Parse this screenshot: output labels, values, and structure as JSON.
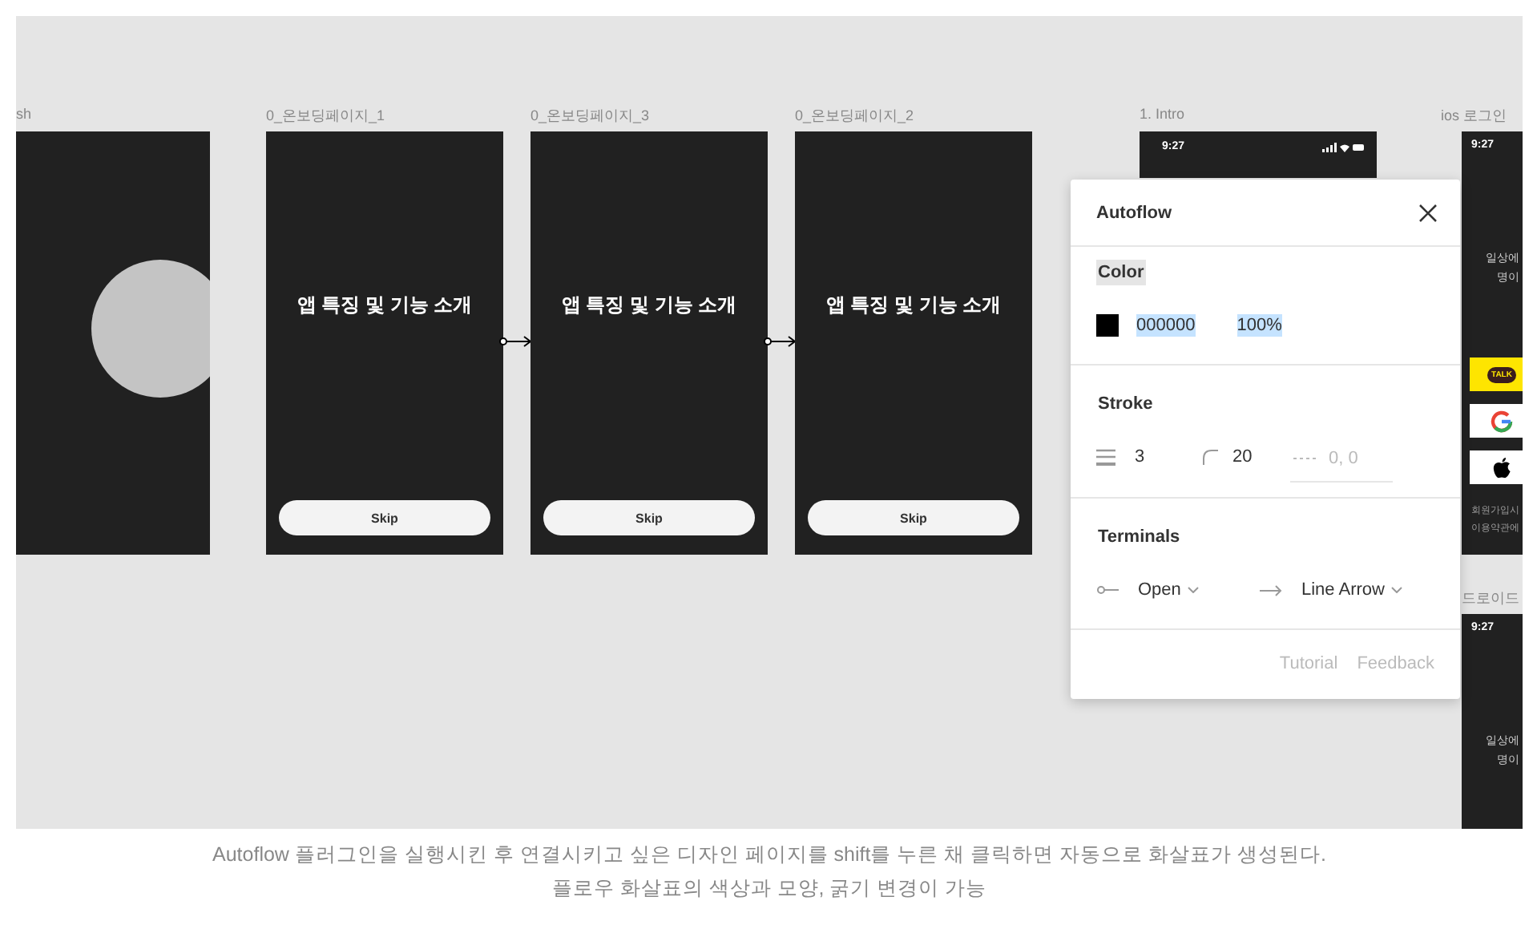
{
  "canvas": {
    "frames": [
      {
        "kind": "splash",
        "label": "sh"
      },
      {
        "kind": "onboarding",
        "label": "0_온보딩페이지_1",
        "heading": "앱 특징 및 기능 소개",
        "button": "Skip",
        "flow_out": true
      },
      {
        "kind": "onboarding",
        "label": "0_온보딩페이지_3",
        "heading": "앱 특징 및 기능 소개",
        "button": "Skip",
        "flow_out": true
      },
      {
        "kind": "onboarding",
        "label": "0_온보딩페이지_2",
        "heading": "앱 특징 및 기능 소개",
        "button": "Skip",
        "flow_out": false
      },
      {
        "kind": "phone",
        "label": "1. Intro",
        "time": "9:27"
      },
      {
        "kind": "login",
        "label": "ios 로그인",
        "time": "9:27",
        "lines": [
          "일상에",
          "명이"
        ],
        "talk": "TALK",
        "footer": [
          "회원가입시",
          "이용약관에"
        ]
      },
      {
        "kind": "phone_text",
        "label": "드로이드",
        "time": "9:27",
        "lines": [
          "일상에",
          "명이"
        ]
      }
    ]
  },
  "panel": {
    "title": "Autoflow",
    "color": {
      "label": "Color",
      "label_selected": true,
      "hex": "000000",
      "opacity": "100%",
      "values_selected": true
    },
    "stroke": {
      "label": "Stroke",
      "weight": "3",
      "radius": "20",
      "dash_placeholder": "0, 0"
    },
    "terminals": {
      "label": "Terminals",
      "start": "Open",
      "end": "Line Arrow"
    },
    "footer": [
      "Tutorial",
      "Feedback"
    ]
  },
  "caption": [
    "Autoflow 플러그인을 실행시킨 후 연결시키고 싶은 디자인 페이지를 shift를 누른 채 클릭하면 자동으로 화살표가 생성된다.",
    "플로우 화살표의 색상과 모양, 굵기 변경이 가능"
  ]
}
